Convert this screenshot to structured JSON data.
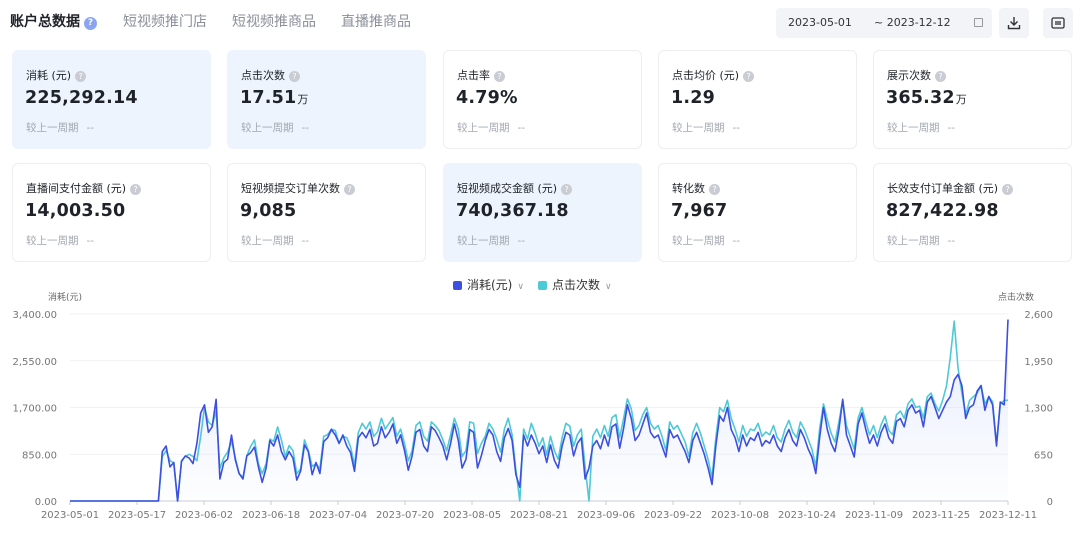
{
  "tabs": [
    {
      "label": "账户总数据",
      "active": true
    },
    {
      "label": "短视频推门店",
      "active": false
    },
    {
      "label": "短视频推商品",
      "active": false
    },
    {
      "label": "直播推商品",
      "active": false
    }
  ],
  "date_range": {
    "start": "2023-05-01",
    "separator": "~",
    "end": "2023-12-12"
  },
  "toolbar_icons": [
    "download-icon",
    "columns-icon"
  ],
  "metrics": [
    {
      "label": "消耗 (元)",
      "value": "225,292.14",
      "unit": "",
      "compare_label": "较上一周期",
      "compare_value": "--",
      "selected": true
    },
    {
      "label": "点击次数",
      "value": "17.51",
      "unit": "万",
      "compare_label": "较上一周期",
      "compare_value": "--",
      "selected": true
    },
    {
      "label": "点击率",
      "value": "4.79%",
      "unit": "",
      "compare_label": "较上一周期",
      "compare_value": "--",
      "selected": false
    },
    {
      "label": "点击均价 (元)",
      "value": "1.29",
      "unit": "",
      "compare_label": "较上一周期",
      "compare_value": "--",
      "selected": false
    },
    {
      "label": "展示次数",
      "value": "365.32",
      "unit": "万",
      "compare_label": "较上一周期",
      "compare_value": "--",
      "selected": false
    },
    {
      "label": "直播间支付金额 (元)",
      "value": "14,003.50",
      "unit": "",
      "compare_label": "较上一周期",
      "compare_value": "--",
      "selected": false
    },
    {
      "label": "短视频提交订单次数",
      "value": "9,085",
      "unit": "",
      "compare_label": "较上一周期",
      "compare_value": "--",
      "selected": false
    },
    {
      "label": "短视频成交金额 (元)",
      "value": "740,367.18",
      "unit": "",
      "compare_label": "较上一周期",
      "compare_value": "--",
      "selected": true
    },
    {
      "label": "转化数",
      "value": "7,967",
      "unit": "",
      "compare_label": "较上一周期",
      "compare_value": "--",
      "selected": false
    },
    {
      "label": "长效支付订单金额 (元)",
      "value": "827,422.98",
      "unit": "",
      "compare_label": "较上一周期",
      "compare_value": "--",
      "selected": false
    }
  ],
  "chart_data": {
    "type": "line",
    "legend": [
      {
        "name": "消耗(元)",
        "color": "#3d4fe0"
      },
      {
        "name": "点击次数",
        "color": "#4ec9d6"
      }
    ],
    "ylabel_left": "消耗(元)",
    "ylabel_right": "点击次数",
    "y_left_ticks": [
      "3,400.00",
      "2,550.00",
      "1,700.00",
      "850.00",
      "0.00"
    ],
    "y_right_ticks": [
      "2,600",
      "1,950",
      "1,300",
      "650",
      "0"
    ],
    "ylim_left": [
      0,
      3400
    ],
    "ylim_right": [
      0,
      2600
    ],
    "x_tick_labels": [
      "2023-05-01",
      "2023-05-17",
      "2023-06-02",
      "2023-06-18",
      "2023-07-04",
      "2023-07-20",
      "2023-08-05",
      "2023-08-21",
      "2023-09-06",
      "2023-09-22",
      "2023-10-08",
      "2023-10-24",
      "2023-11-09",
      "2023-11-25",
      "2023-12-11"
    ],
    "x_start": "2023-05-01",
    "x_end": "2023-12-12",
    "series": [
      {
        "name": "消耗(元)",
        "color": "#3d4fe0",
        "values": [
          0,
          0,
          0,
          0,
          0,
          0,
          0,
          0,
          0,
          0,
          0,
          0,
          0,
          0,
          0,
          0,
          0,
          0,
          0,
          0,
          0,
          0,
          0,
          0,
          900,
          1000,
          620,
          700,
          0,
          720,
          820,
          780,
          680,
          1050,
          1600,
          1750,
          1250,
          1350,
          1850,
          400,
          700,
          760,
          1200,
          750,
          500,
          400,
          820,
          880,
          980,
          620,
          340,
          600,
          1100,
          1000,
          1200,
          900,
          750,
          900,
          780,
          380,
          550,
          1020,
          900,
          480,
          700,
          500,
          1080,
          1150,
          1300,
          1200,
          1050,
          1200,
          1000,
          880,
          540,
          1150,
          1250,
          1150,
          1300,
          1000,
          1050,
          1350,
          1150,
          1250,
          1400,
          1050,
          1200,
          920,
          560,
          820,
          1250,
          1300,
          1000,
          900,
          1350,
          1280,
          1150,
          1000,
          750,
          1050,
          1400,
          1100,
          600,
          760,
          1300,
          1250,
          600,
          820,
          1100,
          1300,
          1200,
          900,
          720,
          1150,
          1320,
          1100,
          480,
          250,
          1200,
          1000,
          1200,
          1050,
          860,
          1000,
          700,
          1020,
          740,
          600,
          1000,
          1250,
          1200,
          820,
          1050,
          1150,
          400,
          600,
          1000,
          1100,
          950,
          1200,
          1000,
          1350,
          1400,
          960,
          1320,
          1750,
          1500,
          1100,
          1200,
          1400,
          1600,
          1250,
          1150,
          1200,
          1000,
          800,
          1300,
          1150,
          1200,
          1050,
          900,
          700,
          1100,
          1250,
          1050,
          850,
          600,
          300,
          1000,
          1550,
          1450,
          1700,
          1300,
          1150,
          900,
          1200,
          1000,
          1150,
          1100,
          1250,
          1000,
          1100,
          1050,
          1200,
          1000,
          900,
          1150,
          1300,
          1100,
          1000,
          1300,
          1150,
          950,
          800,
          500,
          1150,
          1700,
          1300,
          1050,
          900,
          1300,
          1850,
          1200,
          1000,
          800,
          1400,
          1600,
          1300,
          1050,
          1200,
          1000,
          1250,
          1400,
          1150,
          1050,
          1450,
          1500,
          1350,
          1650,
          1750,
          1600,
          1650,
          1350,
          1800,
          1900,
          1700,
          1500,
          1650,
          1800,
          1900,
          2200,
          2300,
          2100,
          1500,
          1700,
          1750,
          2000,
          2100,
          1650,
          1900,
          1750,
          1000,
          1800,
          1750,
          3300
        ]
      },
      {
        "name": "点击次数",
        "color": "#4ec9d6",
        "values": [
          0,
          0,
          0,
          0,
          0,
          0,
          0,
          0,
          0,
          0,
          0,
          0,
          0,
          0,
          0,
          0,
          0,
          0,
          0,
          0,
          0,
          0,
          0,
          0,
          620,
          700,
          560,
          530,
          0,
          560,
          620,
          650,
          620,
          560,
          900,
          1300,
          1100,
          1050,
          1250,
          450,
          600,
          680,
          830,
          600,
          380,
          330,
          630,
          760,
          850,
          520,
          380,
          520,
          860,
          830,
          1030,
          850,
          620,
          770,
          700,
          380,
          450,
          850,
          700,
          480,
          520,
          450,
          900,
          920,
          1000,
          980,
          800,
          900,
          880,
          750,
          500,
          950,
          1080,
          1000,
          1100,
          900,
          960,
          1150,
          1000,
          1080,
          1160,
          900,
          1000,
          800,
          560,
          700,
          1050,
          1100,
          900,
          830,
          1100,
          1050,
          980,
          850,
          700,
          920,
          1150,
          1000,
          620,
          700,
          1100,
          1080,
          660,
          800,
          900,
          1080,
          1000,
          860,
          680,
          1000,
          1150,
          920,
          430,
          0,
          1000,
          860,
          1080,
          940,
          760,
          880,
          640,
          900,
          700,
          580,
          880,
          1080,
          1040,
          760,
          920,
          1000,
          480,
          0,
          900,
          1000,
          880,
          1050,
          900,
          1160,
          1200,
          880,
          1150,
          1420,
          1280,
          980,
          1050,
          1200,
          1300,
          1080,
          1000,
          1050,
          900,
          700,
          1100,
          1000,
          1050,
          940,
          820,
          620,
          950,
          1080,
          940,
          760,
          580,
          320,
          880,
          1300,
          1240,
          1400,
          1150,
          1000,
          820,
          1050,
          900,
          1000,
          980,
          1080,
          900,
          960,
          920,
          1050,
          880,
          820,
          1000,
          1120,
          960,
          880,
          1100,
          1000,
          860,
          720,
          480,
          1000,
          1350,
          1130,
          940,
          820,
          1100,
          1400,
          1050,
          880,
          720,
          1150,
          1300,
          1100,
          920,
          1050,
          880,
          1060,
          1180,
          980,
          920,
          1200,
          1250,
          1150,
          1350,
          1420,
          1300,
          1320,
          1150,
          1450,
          1500,
          1350,
          1250,
          1400,
          1600,
          2000,
          2500,
          1850,
          1500,
          1200,
          1400,
          1450,
          1500,
          1600,
          1350,
          1450,
          1380,
          800,
          1350,
          1400,
          1400
        ]
      }
    ]
  }
}
